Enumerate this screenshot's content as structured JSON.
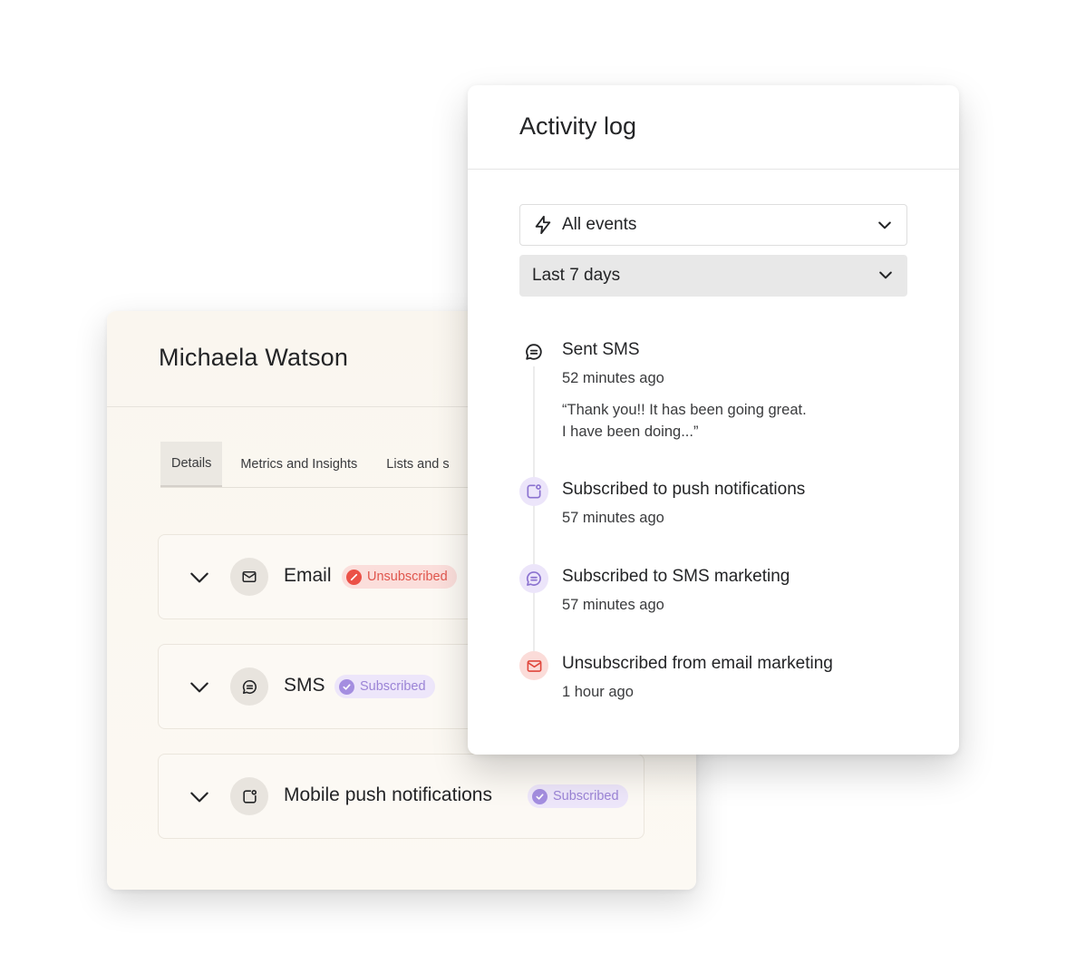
{
  "profile": {
    "name": "Michaela Watson",
    "tabs": [
      {
        "label": "Details",
        "active": true
      },
      {
        "label": "Metrics and Insights",
        "active": false
      },
      {
        "label": "Lists and s",
        "active": false
      }
    ],
    "channels": [
      {
        "label": "Email",
        "icon": "mail-icon",
        "status": "Unsubscribed"
      },
      {
        "label": "SMS",
        "icon": "chat-icon",
        "status": "Subscribed"
      },
      {
        "label": "Mobile push notifications",
        "icon": "push-notification-icon",
        "status": "Subscribed"
      }
    ]
  },
  "activity_log": {
    "title": "Activity log",
    "filters": {
      "event_type": "All events",
      "date_range": "Last 7 days"
    },
    "events": [
      {
        "title": "Sent SMS",
        "time": "52 minutes ago",
        "quote_line1": "“Thank you!! It has been going great.",
        "quote_line2": "I have been doing...”",
        "icon": "chat-icon"
      },
      {
        "title": "Subscribed to push notifications",
        "time": "57 minutes ago",
        "icon": "push-notification-icon"
      },
      {
        "title": "Subscribed to SMS marketing",
        "time": "57 minutes ago",
        "icon": "chat-icon"
      },
      {
        "title": "Unsubscribed from email marketing",
        "time": "1 hour ago",
        "icon": "mail-icon"
      }
    ]
  },
  "colors": {
    "unsubscribed": "#eb5147",
    "subscribed": "#a48ee0",
    "text_primary": "#232426",
    "profile_bg": "#faf6ef"
  }
}
